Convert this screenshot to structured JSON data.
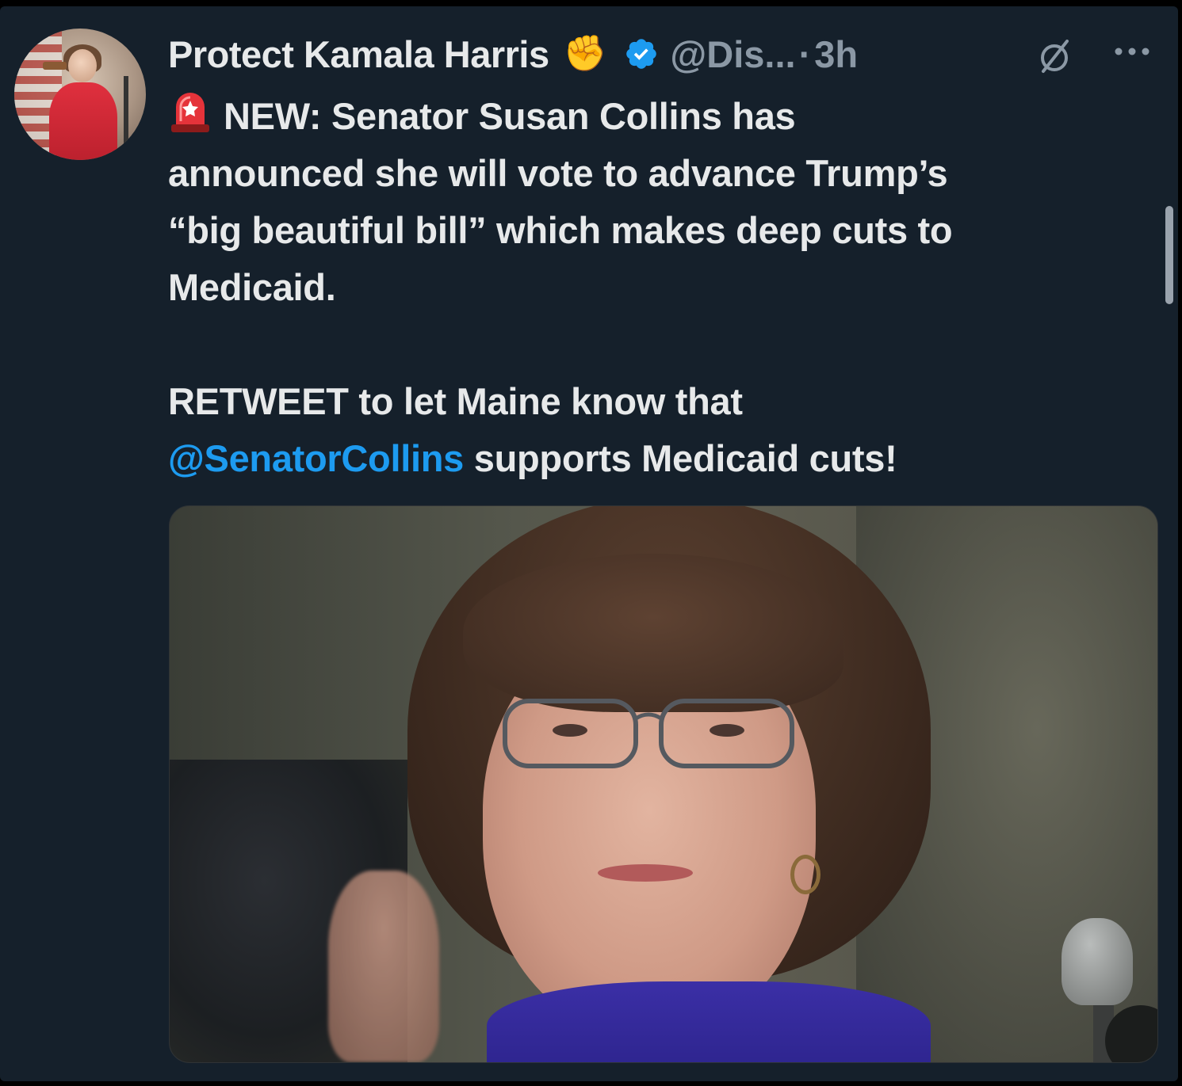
{
  "tweet": {
    "author": {
      "display_name": "Protect Kamala Harris",
      "name_emoji": "✊",
      "handle": "@Dis...",
      "separator": "·",
      "time": "3h",
      "verified": true
    },
    "body": {
      "line1_prefix_icon": "siren-emoji",
      "line1": "NEW: Senator Susan Collins has",
      "line2": "announced she will vote to advance Trump’s",
      "line3": "“big beautiful bill” which makes deep cuts to",
      "line4": "Medicaid.",
      "line5": "RETWEET to let Maine know that",
      "mention": "@SenatorCollins",
      "line6_rest": " supports Medicaid cuts!"
    },
    "icons": {
      "verified": "verified-badge-icon",
      "grok": "grok-icon",
      "more": "more-options-icon"
    },
    "colors": {
      "background": "#15202b",
      "text": "#e7e9ea",
      "secondary_text": "#8b98a5",
      "link": "#1d9bf0",
      "verified": "#1d9bf0"
    }
  }
}
